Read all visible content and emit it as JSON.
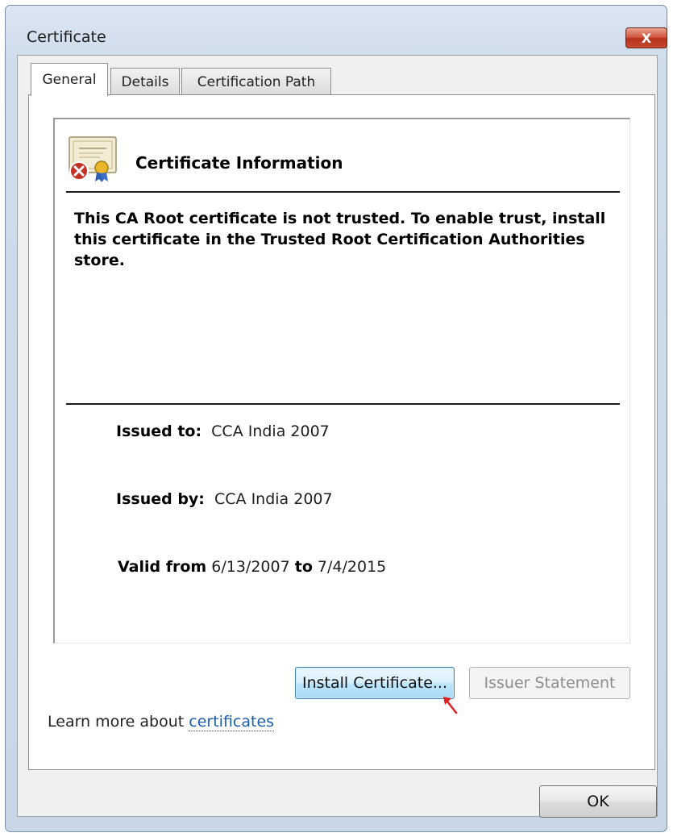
{
  "window": {
    "title": "Certificate",
    "close_label": "X"
  },
  "tabs": [
    {
      "label": "General",
      "active": true
    },
    {
      "label": "Details",
      "active": false
    },
    {
      "label": "Certification Path",
      "active": false
    }
  ],
  "info": {
    "title": "Certificate Information",
    "warning": "This CA Root certificate is not trusted. To enable trust, install this certificate in the Trusted Root Certification Authorities store.",
    "issued_to_label": "Issued to:",
    "issued_to": "CCA India 2007",
    "issued_by_label": "Issued by:",
    "issued_by": "CCA India 2007",
    "valid_from_label": "Valid from",
    "valid_from": "6/13/2007",
    "to_label": "to",
    "valid_to": "7/4/2015"
  },
  "buttons": {
    "install": "Install Certificate...",
    "issuer_statement": "Issuer Statement",
    "ok": "OK"
  },
  "learn_more": {
    "text": "Learn more about",
    "link": "certificates"
  },
  "icons": {
    "cert": "certificate-error-icon",
    "close": "close-icon",
    "cursor": "mouse-cursor-icon"
  },
  "colors": {
    "close_button": "#c44a2e",
    "link": "#1d5eaa",
    "focus_button": "#bee6fd",
    "cursor": "#e02020"
  }
}
